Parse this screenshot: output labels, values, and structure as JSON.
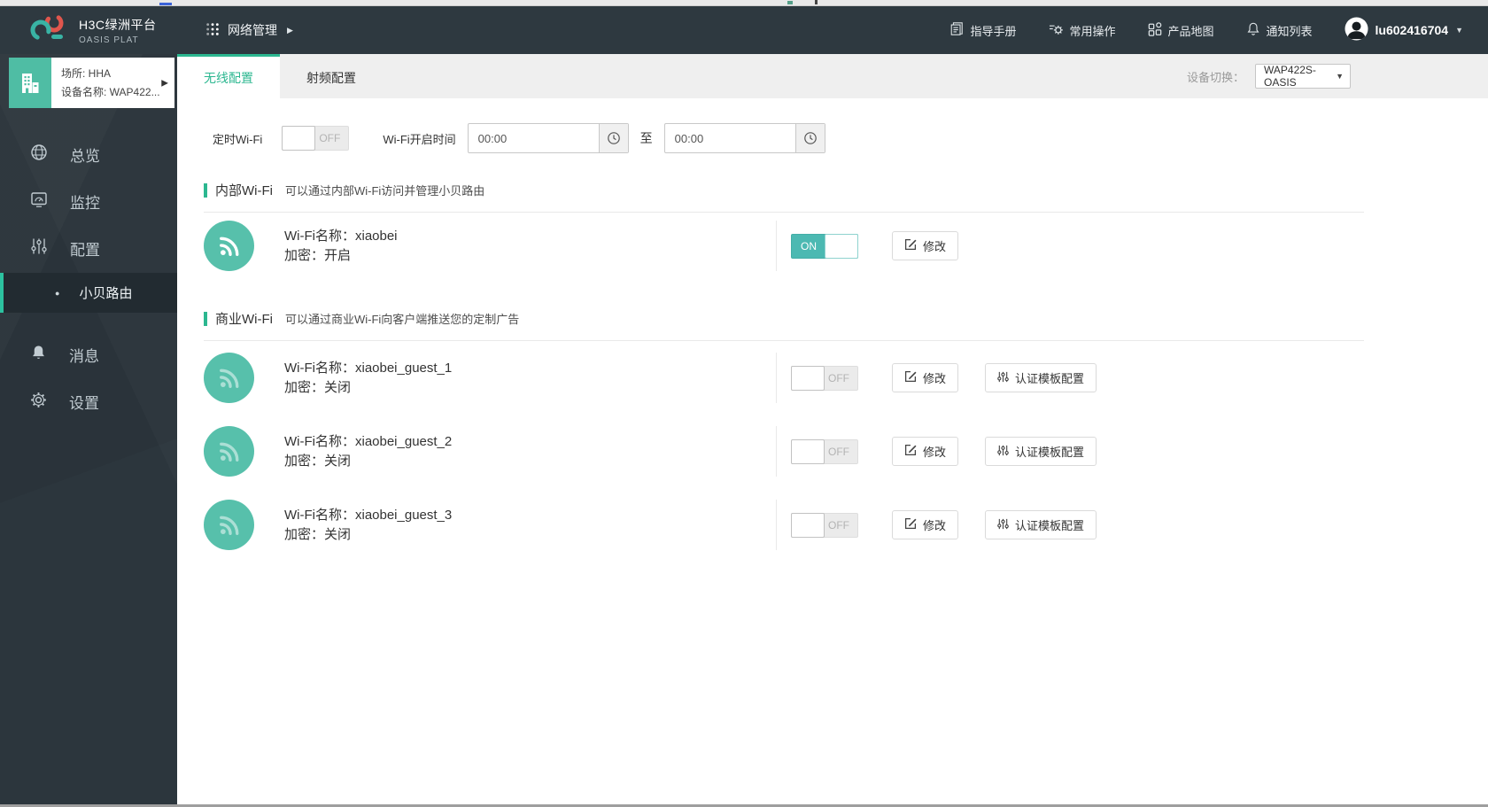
{
  "colors": {
    "accent_green": "#2cb790",
    "toggle_teal": "#4cb9b2",
    "wifi_badge_teal": "#57c0ab",
    "device_tile_green": "#4fbda4",
    "header_bg": "#2e3940",
    "sidebar_bg": "#2c363d",
    "logo_red": "#e0564d",
    "logo_teal": "#39b3a4"
  },
  "glyphs": {
    "caret_right": "▶",
    "caret_down": "▼",
    "bullet": "●"
  },
  "header": {
    "title": "H3C绿洲平台",
    "subtitle": "OASIS PLAT",
    "nav": "网络管理",
    "actions": [
      {
        "label": "指导手册",
        "icon": "manual-doc-icon"
      },
      {
        "label": "常用操作",
        "icon": "operations-gear-icon"
      },
      {
        "label": "产品地图",
        "icon": "product-map-icon"
      },
      {
        "label": "通知列表",
        "icon": "notification-bell-icon"
      }
    ],
    "username": "lu602416704"
  },
  "sidebar": {
    "site_label": "场所: HHA",
    "device_label": "设备名称: WAP422...",
    "items": [
      {
        "label": "总览",
        "icon": "globe-icon"
      },
      {
        "label": "监控",
        "icon": "monitor-icon"
      },
      {
        "label": "配置",
        "icon": "sliders-icon"
      },
      {
        "label": "小贝路由",
        "icon": "bullet",
        "active": true
      },
      {
        "label": "消息",
        "icon": "bell-icon"
      },
      {
        "label": "设置",
        "icon": "gear-icon"
      }
    ]
  },
  "tabbar": {
    "tabs": [
      {
        "label": "无线配置",
        "active": true
      },
      {
        "label": "射频配置",
        "active": false
      }
    ],
    "device_switch_label": "设备切换：",
    "device_switch_value": "WAP422S-OASIS"
  },
  "content": {
    "schedule_label": "定时Wi-Fi",
    "schedule_state": "OFF",
    "time_label": "Wi-Fi开启时间",
    "time_start": "00:00",
    "to_label": "至",
    "time_end": "00:00",
    "toggle_on_label": "ON",
    "toggle_off_label": "OFF",
    "modify_label": "修改",
    "auth_label": "认证模板配置",
    "sections": [
      {
        "title": "内部Wi-Fi",
        "desc": "可以通过内部Wi-Fi访问并管理小贝路由",
        "rows": [
          {
            "name_label": "Wi-Fi名称：",
            "name": "xiaobei",
            "enc_label": "加密：",
            "enc": "开启",
            "state": "ON"
          }
        ]
      },
      {
        "title": "商业Wi-Fi",
        "desc": "可以通过商业Wi-Fi向客户端推送您的定制广告",
        "rows": [
          {
            "name_label": "Wi-Fi名称：",
            "name": "xiaobei_guest_1",
            "enc_label": "加密：",
            "enc": "关闭",
            "state": "OFF"
          },
          {
            "name_label": "Wi-Fi名称：",
            "name": "xiaobei_guest_2",
            "enc_label": "加密：",
            "enc": "关闭",
            "state": "OFF"
          },
          {
            "name_label": "Wi-Fi名称：",
            "name": "xiaobei_guest_3",
            "enc_label": "加密：",
            "enc": "关闭",
            "state": "OFF"
          }
        ]
      }
    ]
  }
}
